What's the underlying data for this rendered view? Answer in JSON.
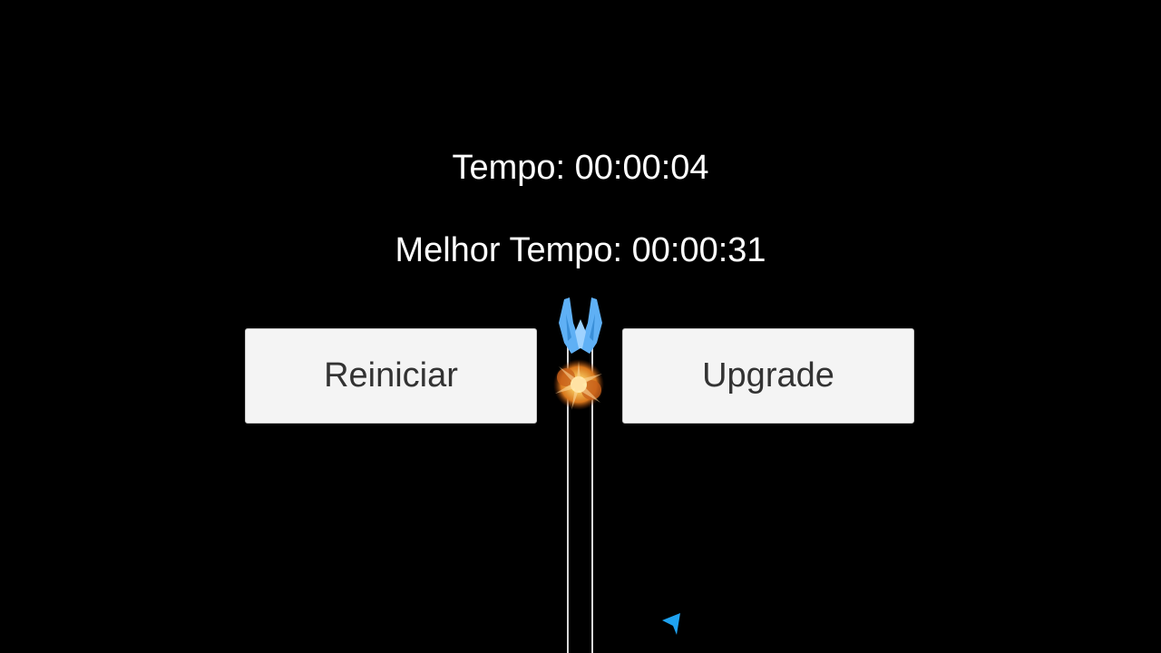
{
  "hud": {
    "time_text": "Tempo: 00:00:04",
    "best_time_text": "Melhor Tempo: 00:00:31"
  },
  "buttons": {
    "restart_label": "Reiniciar",
    "upgrade_label": "Upgrade"
  },
  "scene": {
    "background_color": "#000000",
    "player_ship_icon": "blue-spaceship-icon",
    "explosion_icon": "orange-explosion-icon",
    "cursor_icon": "blue-arrow-cursor-icon",
    "ship_color": "#5fb0f5",
    "beam_color": "#d8d8d8"
  }
}
